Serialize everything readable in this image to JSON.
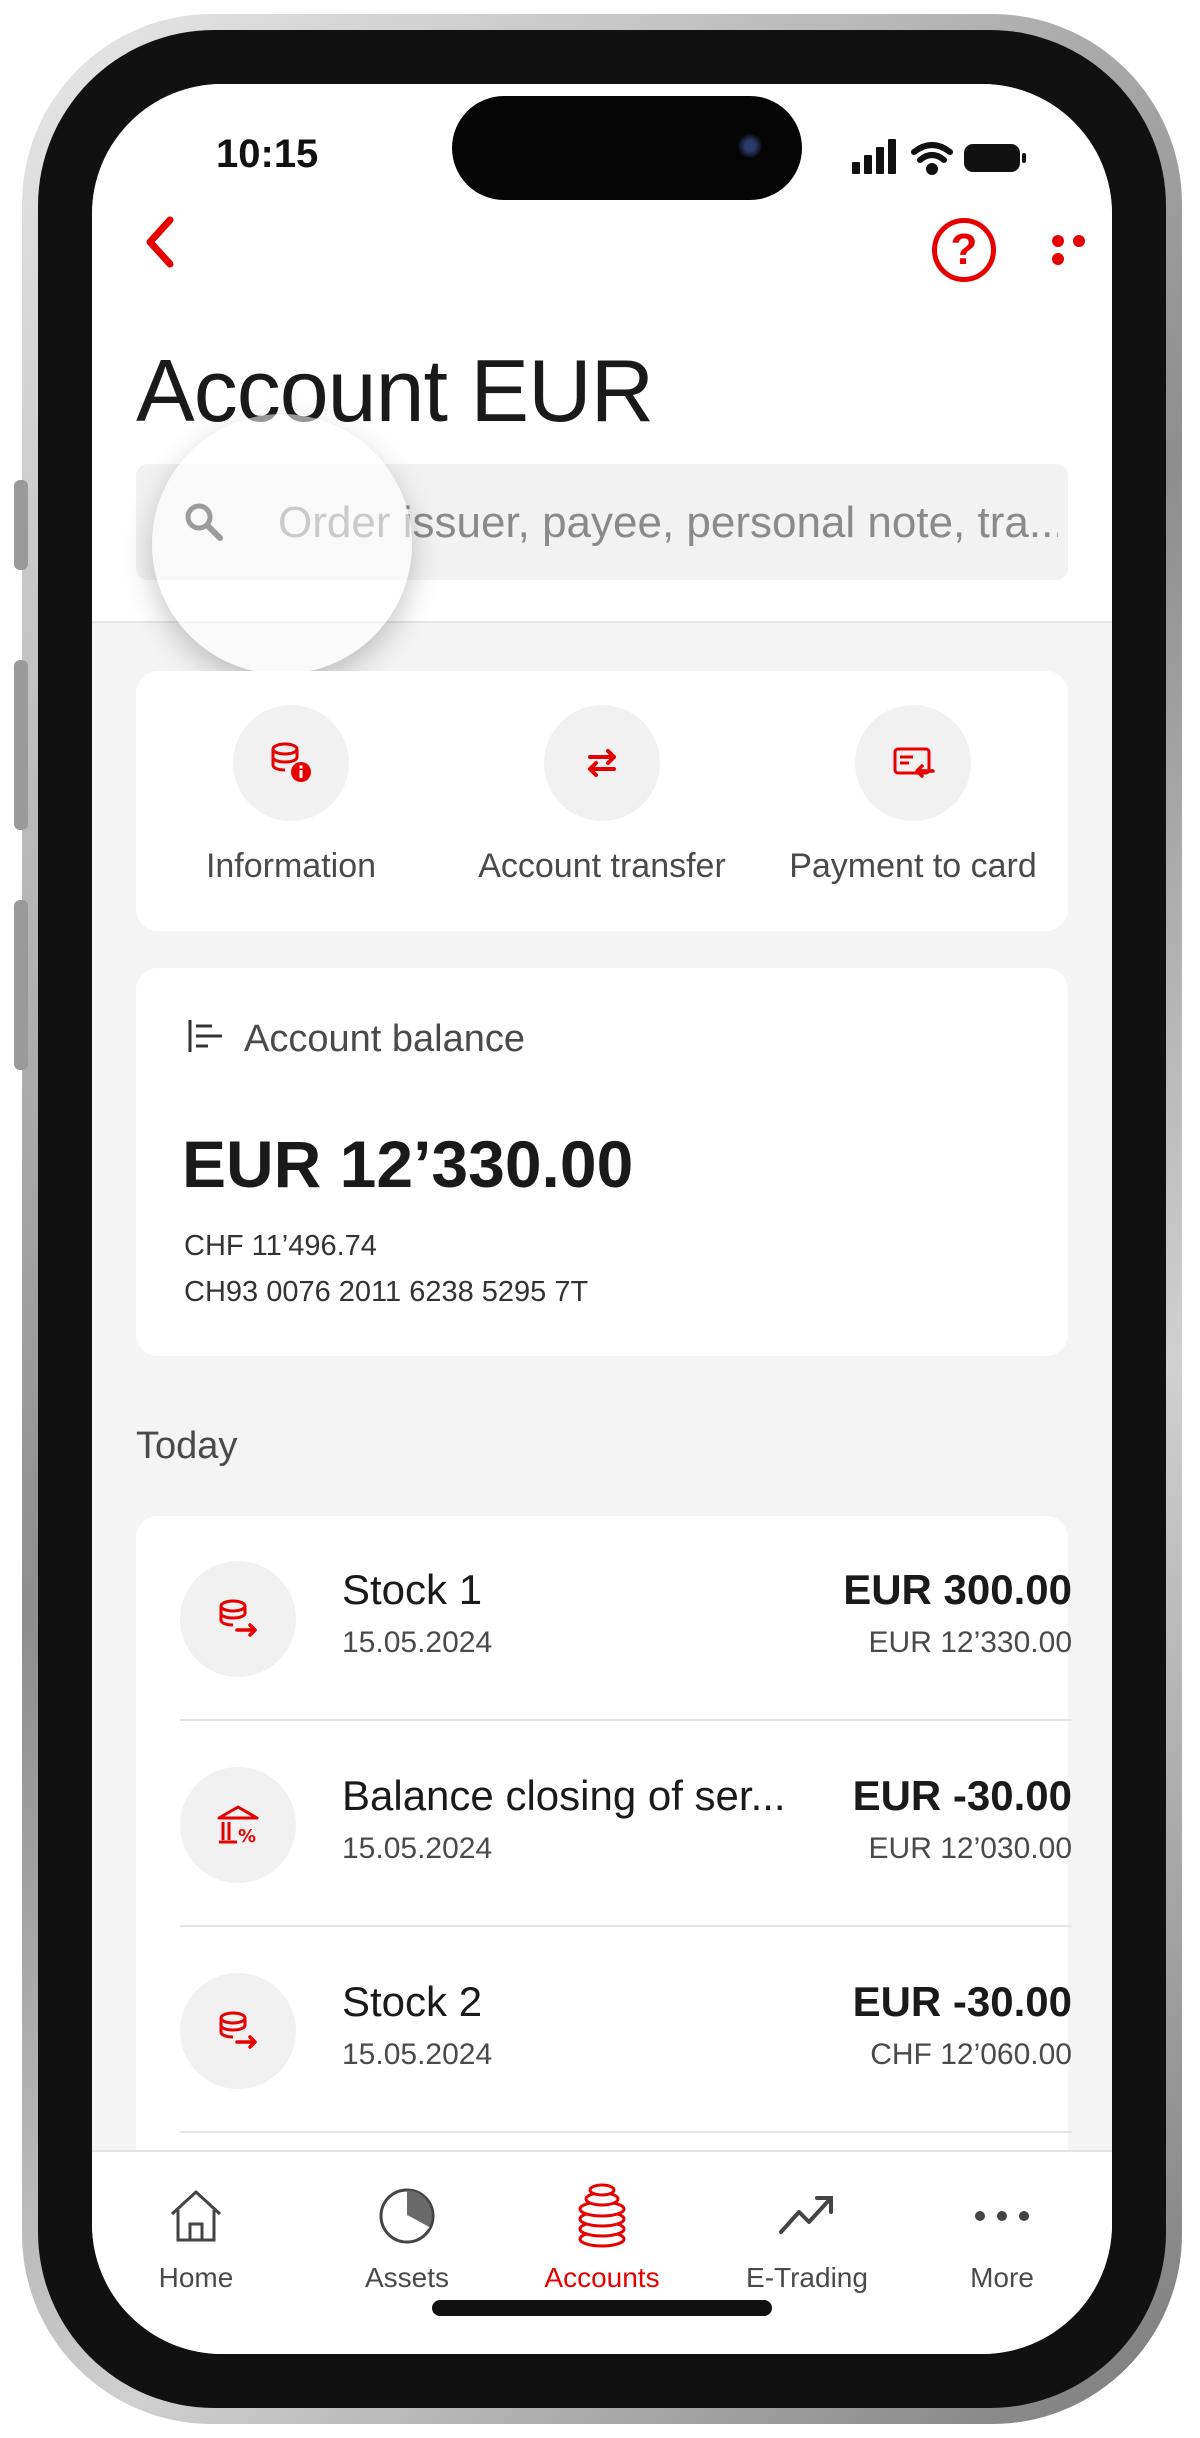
{
  "status_bar": {
    "time": "10:15"
  },
  "header": {
    "title": "Account EUR"
  },
  "search": {
    "placeholder": "Order issuer, payee, personal note, tra..."
  },
  "actions": [
    {
      "label": "Information",
      "icon": "coins-info-icon"
    },
    {
      "label": "Account transfer",
      "icon": "transfer-arrows-icon"
    },
    {
      "label": "Payment to card",
      "icon": "card-payment-icon"
    }
  ],
  "balance": {
    "heading": "Account balance",
    "amount": "EUR 12’330.00",
    "chf": "CHF 11’496.74",
    "iban": "CH93 0076 2011 6238 5295 7T"
  },
  "transactions_section": "Today",
  "transactions": [
    {
      "name": "Stock 1",
      "date": "15.05.2024",
      "amount": "EUR 300.00",
      "balance": "EUR 12’330.00",
      "icon": "coins-arrow-icon"
    },
    {
      "name": "Balance closing of ser...",
      "date": "15.05.2024",
      "amount": "EUR -30.00",
      "balance": "EUR 12’030.00",
      "icon": "bank-percent-icon"
    },
    {
      "name": "Stock 2",
      "date": "15.05.2024",
      "amount": "EUR -30.00",
      "balance": "CHF 12’060.00",
      "icon": "coins-arrow-icon"
    }
  ],
  "nav": [
    {
      "label": "Home",
      "icon": "home-icon",
      "active": false
    },
    {
      "label": "Assets",
      "icon": "pie-chart-icon",
      "active": false
    },
    {
      "label": "Accounts",
      "icon": "coins-stack-icon",
      "active": true
    },
    {
      "label": "E-Trading",
      "icon": "trend-up-icon",
      "active": false
    },
    {
      "label": "More",
      "icon": "more-dots-icon",
      "active": false
    }
  ],
  "colors": {
    "accent": "#e60000",
    "background": "#f4f4f4",
    "card": "#ffffff"
  }
}
